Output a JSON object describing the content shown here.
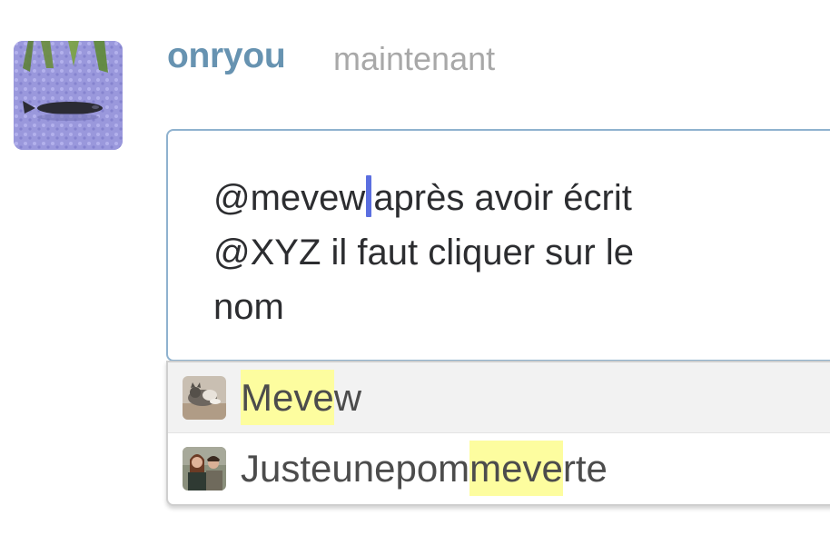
{
  "message": {
    "author": "onryou",
    "timestamp": "maintenant",
    "avatar_icon": "fish-photo-avatar"
  },
  "composer": {
    "mention": "@mevew",
    "text_line1": "après avoir écrit",
    "text_line2": "@XYZ il faut cliquer sur le",
    "text_line3": "nom"
  },
  "autocomplete": {
    "highlight_color": "#fdfd9f",
    "items": [
      {
        "name_prefix": "",
        "name_match": "Meve",
        "name_suffix": "w",
        "avatar_icon": "cat-photo-avatar",
        "selected": true
      },
      {
        "name_prefix": "Justeunepom",
        "name_match": "meve",
        "name_suffix": "rte",
        "avatar_icon": "people-photo-avatar",
        "selected": false
      }
    ]
  },
  "colors": {
    "username": "#6793b1",
    "timestamp": "#a8a8a8",
    "caret": "#5b6fe0",
    "editor_border": "#8fb2cf"
  }
}
